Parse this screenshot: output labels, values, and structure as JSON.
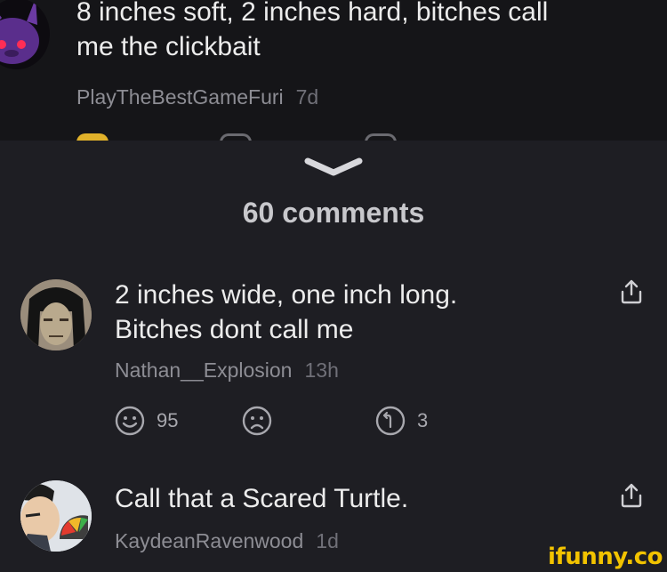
{
  "top_comment": {
    "text_line1": "8 inches soft, 2 inches hard, bitches call",
    "text_line2": "me the clickbait",
    "username": "PlayTheBestGameFuri",
    "time": "7d"
  },
  "sheet": {
    "comment_count_title": "60 comments"
  },
  "comments": [
    {
      "text_line1": "2 inches wide, one inch long.",
      "text_line2": "Bitches dont call me",
      "username": "Nathan__Explosion",
      "time": "13h",
      "like_count": "95",
      "reply_count": "3"
    },
    {
      "text_line1": "Call that a Scared Turtle.",
      "username": "KaydeanRavenwood",
      "time": "1d"
    }
  ],
  "watermark": "ifunny.co",
  "colors": {
    "background": "#1e1e23",
    "top_background": "#151518",
    "text": "#ececec",
    "secondary_text": "#8d8d94",
    "watermark": "#f2c300"
  },
  "icons": [
    "chevron-down-icon",
    "share-icon",
    "smile-icon",
    "frown-icon",
    "reply-icon"
  ]
}
